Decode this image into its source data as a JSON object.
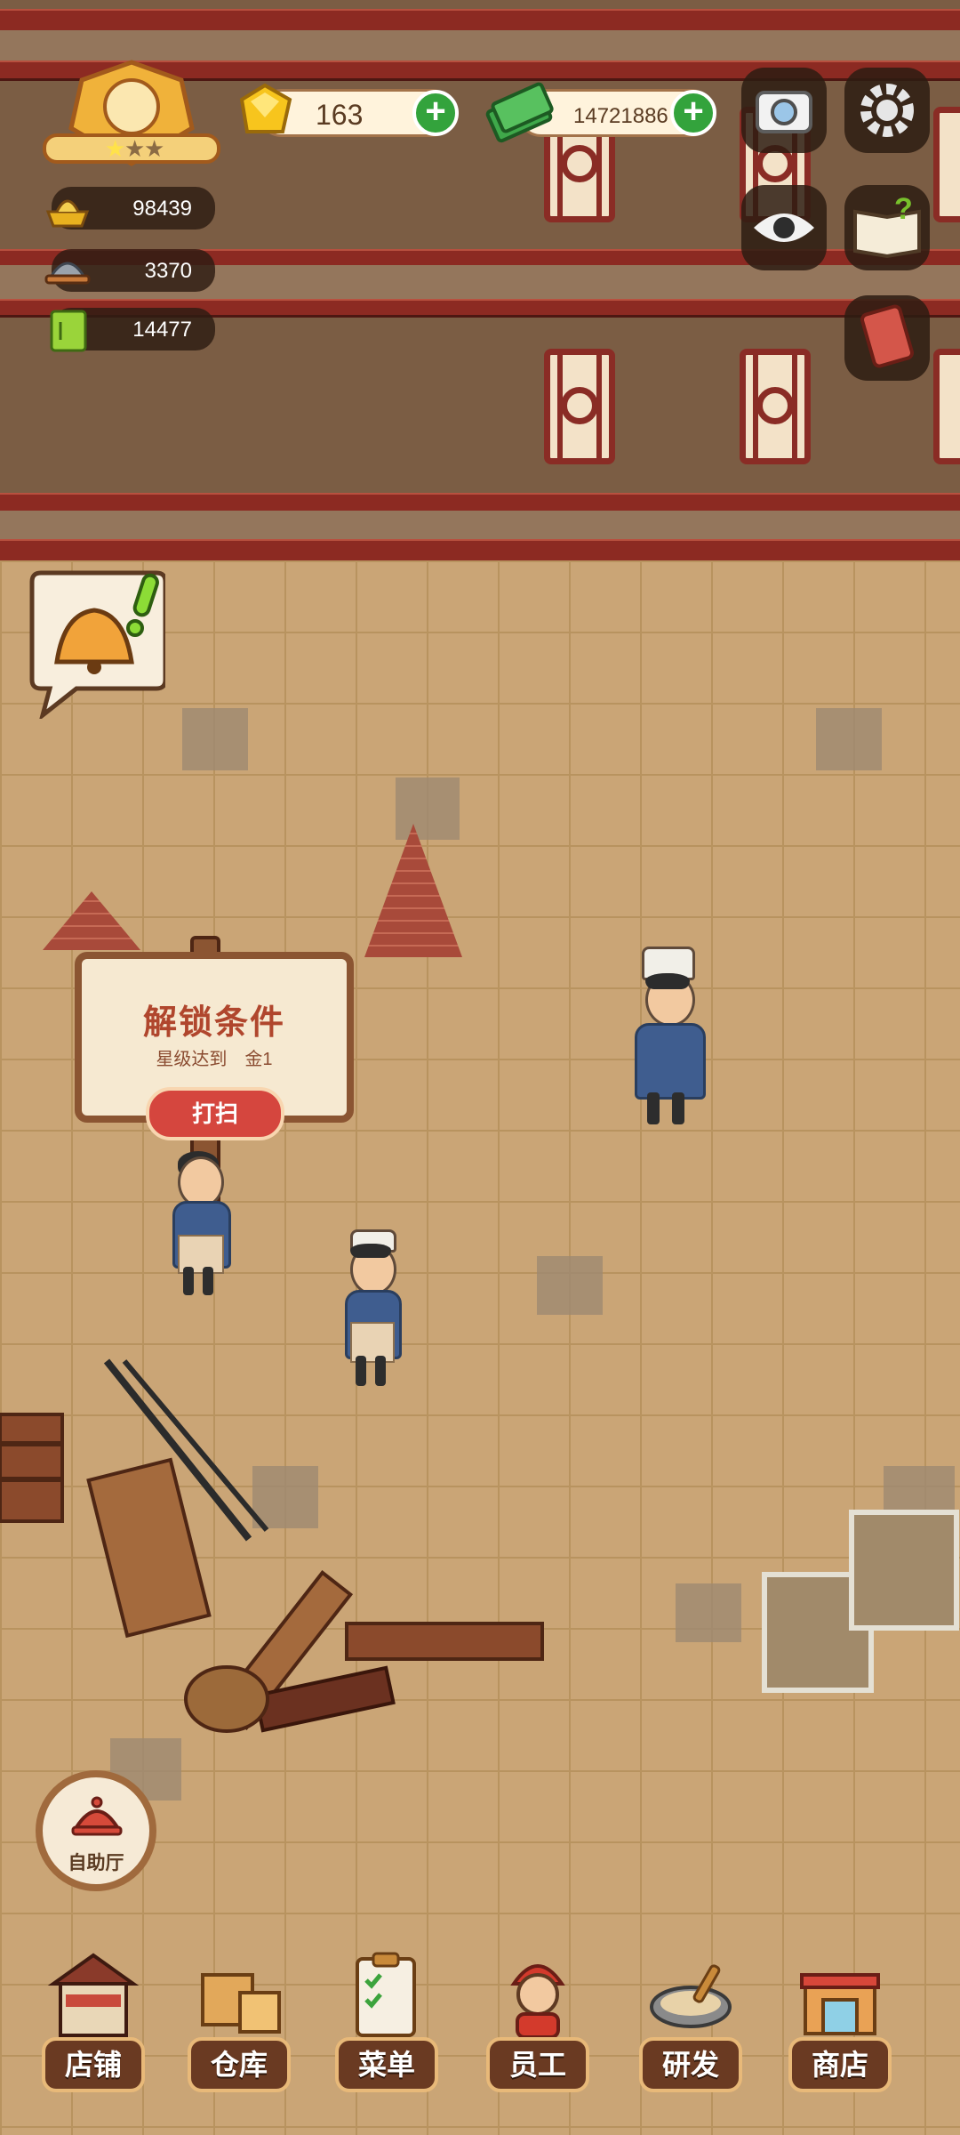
{
  "hud": {
    "gem_count": "163",
    "cash_count": "14721886",
    "gold_count": "98439",
    "dish_count": "3370",
    "recipe_count": "14477",
    "star_rating": 1
  },
  "unlock_sign": {
    "title": "解锁条件",
    "requirement": "星级达到　金1",
    "action_label": "打扫"
  },
  "buffet_button": {
    "label": "自助厅"
  },
  "nav": {
    "items": [
      {
        "label": "店铺",
        "icon": "shop-building-icon"
      },
      {
        "label": "仓库",
        "icon": "warehouse-boxes-icon"
      },
      {
        "label": "菜单",
        "icon": "menu-clipboard-icon"
      },
      {
        "label": "员工",
        "icon": "staff-waitress-icon"
      },
      {
        "label": "研发",
        "icon": "research-wok-icon"
      },
      {
        "label": "商店",
        "icon": "store-stall-icon"
      }
    ]
  },
  "colors": {
    "wall": "#7b5d44",
    "rail": "#8c2a22",
    "floor": "#caa576",
    "accent_green": "#33a33c",
    "button_red": "#d5463e"
  }
}
